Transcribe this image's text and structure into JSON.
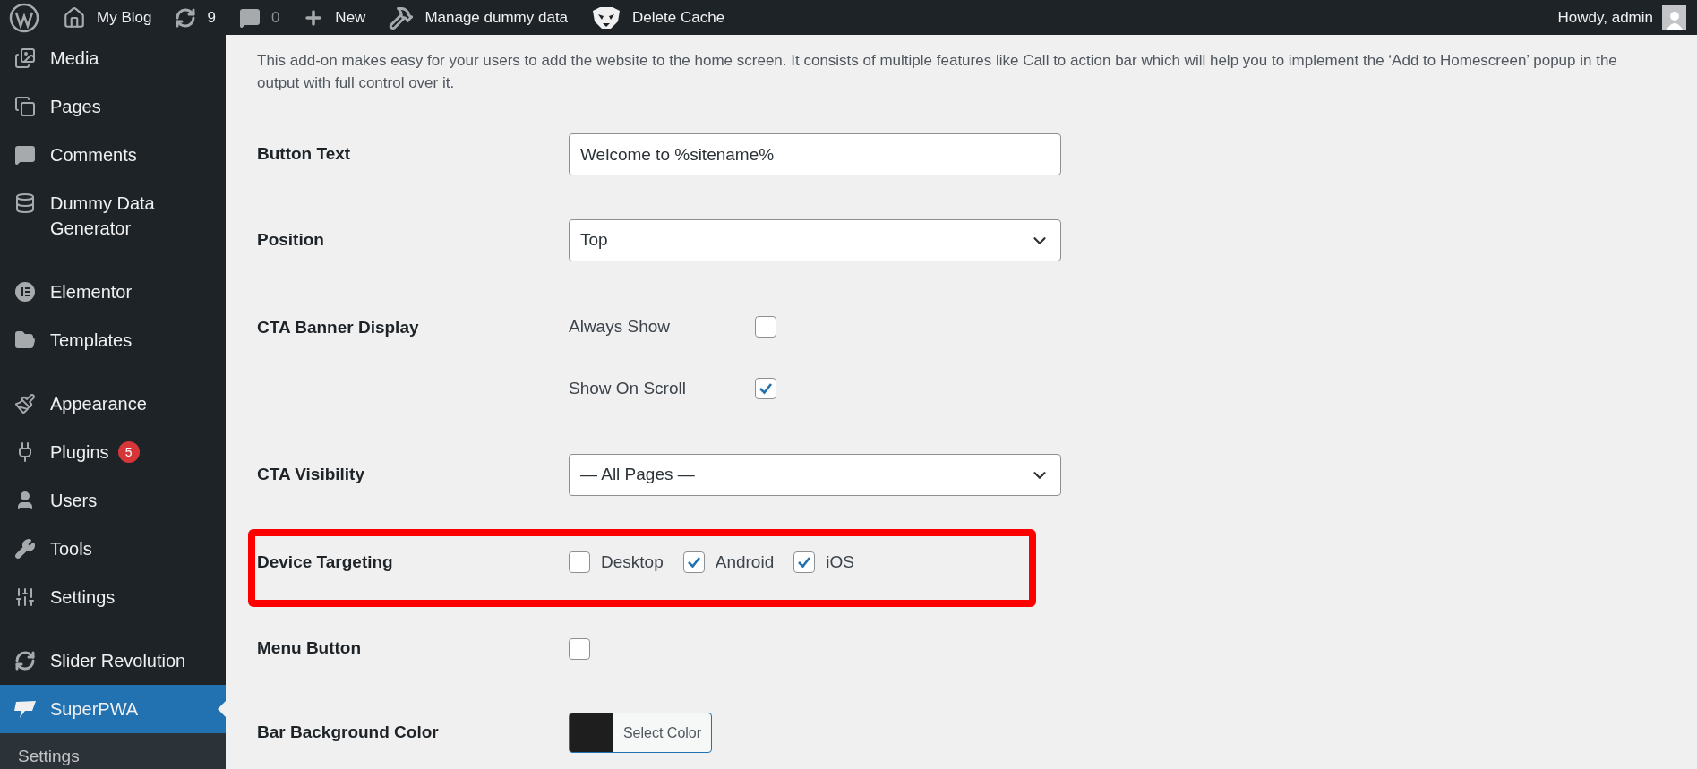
{
  "admin_bar": {
    "items": [
      {
        "label": "My Blog",
        "disabled": false
      },
      {
        "label": "9",
        "disabled": false
      },
      {
        "label": "0",
        "disabled": true
      },
      {
        "label": "New",
        "disabled": false
      },
      {
        "label": "Manage dummy data",
        "disabled": false
      },
      {
        "label": "Delete Cache",
        "disabled": false
      }
    ],
    "account": "Howdy, admin"
  },
  "sidebar": {
    "groups": [
      [
        {
          "label": "Media",
          "selected": false
        },
        {
          "label": "Pages",
          "selected": false
        },
        {
          "label": "Comments",
          "selected": false
        },
        {
          "label": "Dummy Data Generator",
          "selected": false
        }
      ],
      [
        {
          "label": "Elementor",
          "selected": false
        },
        {
          "label": "Templates",
          "selected": false
        }
      ],
      [
        {
          "label": "Appearance",
          "selected": false
        },
        {
          "label": "Plugins",
          "selected": false,
          "badge": "5"
        },
        {
          "label": "Users",
          "selected": false
        },
        {
          "label": "Tools",
          "selected": false
        },
        {
          "label": "Settings",
          "selected": false
        }
      ],
      [
        {
          "label": "Slider Revolution",
          "selected": false
        },
        {
          "label": "SuperPWA",
          "selected": true
        }
      ]
    ],
    "submenu": [
      {
        "label": "Settings"
      }
    ]
  },
  "description": "This add-on makes easy for your users to add the website to the home screen. It consists of multiple features like Call to action bar which will help you to implement the ‘Add to Homescreen’ popup in the output with full control over it.",
  "rows": [
    {
      "label": "Button Text",
      "kind": "text",
      "value": "Welcome to %sitename%"
    },
    {
      "label": "Position",
      "kind": "select",
      "value": "Top"
    },
    {
      "label": "CTA Banner Display",
      "kind": "options",
      "options": [
        {
          "label": "Always Show",
          "checked": false
        },
        {
          "label": "Show On Scroll",
          "checked": true
        }
      ]
    },
    {
      "label": "CTA Visibility",
      "kind": "select",
      "value": "— All Pages —"
    },
    {
      "label": "Device Targeting",
      "kind": "inline_checks",
      "highlighted": true,
      "options": [
        {
          "label": "Desktop",
          "checked": false
        },
        {
          "label": "Android",
          "checked": true
        },
        {
          "label": "iOS",
          "checked": true
        }
      ]
    },
    {
      "label": "Menu Button",
      "kind": "checkbox",
      "checked": false
    },
    {
      "label": "Bar Background Color",
      "kind": "color",
      "button": "Select Color"
    }
  ]
}
